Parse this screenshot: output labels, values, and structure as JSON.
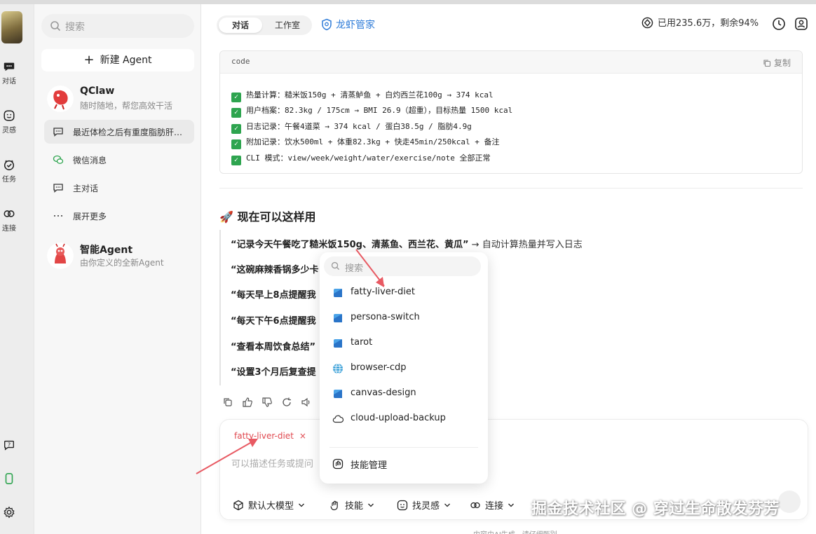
{
  "rail": {
    "items": [
      {
        "label": "对话",
        "icon": "chat-icon"
      },
      {
        "label": "灵感",
        "icon": "smile-icon"
      },
      {
        "label": "任务",
        "icon": "task-check-icon"
      },
      {
        "label": "连接",
        "icon": "link-icon"
      }
    ]
  },
  "sidebar": {
    "search_placeholder": "搜索",
    "new_agent": "新建 Agent",
    "qclaw": {
      "name": "QClaw",
      "desc": "随时随地，帮您高效干活"
    },
    "rows": [
      {
        "label": "最近体检之后有重度脂肪肝…",
        "icon": "chat-bubble-icon",
        "active": true
      },
      {
        "label": "微信消息",
        "icon": "wechat-icon",
        "active": false
      },
      {
        "label": "主对话",
        "icon": "chat-bubble-icon",
        "active": false
      },
      {
        "label": "展开更多",
        "icon": "more-dots-icon",
        "active": false
      }
    ],
    "smart_agent": {
      "name": "智能Agent",
      "desc": "由你定义的全新Agent"
    }
  },
  "header": {
    "tabs": [
      {
        "label": "对话",
        "active": true
      },
      {
        "label": "工作室",
        "active": false
      }
    ],
    "guard": "龙虾管家",
    "usage": "已用235.6万，剩余94%"
  },
  "code": {
    "lang": "code",
    "copy": "复制",
    "lines": [
      "热量计算：糙米饭150g + 清蒸鲈鱼 + 白灼西兰花100g → 374 kcal",
      "用户档案：82.3kg / 175cm → BMI 26.9（超重），目标热量 1500 kcal",
      "日志记录：午餐4道菜 → 374 kcal / 蛋白38.5g / 脂肪4.9g",
      "附加记录：饮水500ml + 体重82.3kg + 快走45min/250kcal + 备注",
      "CLI 模式：view/week/weight/water/exercise/note 全部正常"
    ]
  },
  "usage_section": {
    "title": "🚀 现在可以这样用",
    "lines": [
      {
        "bold": "“记录今天午餐吃了糙米饭150g、清蒸鱼、西兰花、黄瓜”",
        "rest": " → 自动计算热量并写入日志"
      },
      {
        "bold": "“这碗麻辣香锅多少卡",
        "rest": ""
      },
      {
        "bold": "“每天早上8点提醒我",
        "rest": ""
      },
      {
        "bold": "“每天下午6点提醒我",
        "rest": ""
      },
      {
        "bold": "“查看本周饮食总结”",
        "rest": ""
      },
      {
        "bold": "“设置3个月后复查提",
        "rest": ""
      }
    ]
  },
  "composer": {
    "skill_chip": "fatty-liver-diet",
    "chip_close": "×",
    "placeholder": "可以描述任务或提问",
    "tools": [
      "默认大模型",
      "技能",
      "找灵感",
      "连接"
    ]
  },
  "dropdown": {
    "search_placeholder": "搜索",
    "items": [
      {
        "label": "fatty-liver-diet",
        "icon": "skill-cube-icon"
      },
      {
        "label": "persona-switch",
        "icon": "skill-cube-icon"
      },
      {
        "label": "tarot",
        "icon": "skill-cube-icon"
      },
      {
        "label": "browser-cdp",
        "icon": "globe-icon"
      },
      {
        "label": "canvas-design",
        "icon": "skill-cube-icon"
      },
      {
        "label": "cloud-upload-backup",
        "icon": "cloud-icon"
      }
    ],
    "manage": "技能管理"
  },
  "footer": "内容由AI生成，请仔细甄别",
  "watermark": "掘金技术社区 @ 穿过生命散发芬芳",
  "colors": {
    "accent_blue": "#2f7cd8",
    "skill_red": "#e0484f",
    "check_green": "#2ea44f"
  }
}
